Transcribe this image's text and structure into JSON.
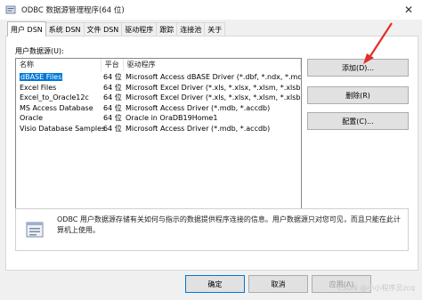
{
  "window": {
    "title": "ODBC 数据源管理程序(64 位)"
  },
  "tabs": [
    "用户 DSN",
    "系统 DSN",
    "文件 DSN",
    "驱动程序",
    "跟踪",
    "连接池",
    "关于"
  ],
  "sources_label": "用户数据源(U):",
  "columns": {
    "name": "名称",
    "platform": "平台",
    "driver": "驱动程序"
  },
  "rows": [
    {
      "name": "dBASE Files",
      "platform": "64 位",
      "driver": "Microsoft Access dBASE Driver (*.dbf, *.ndx, *.md"
    },
    {
      "name": "Excel Files",
      "platform": "64 位",
      "driver": "Microsoft Excel Driver (*.xls, *.xlsx, *.xlsm, *.xlsb)"
    },
    {
      "name": "Excel_to_Oracle12c",
      "platform": "64 位",
      "driver": "Microsoft Excel Driver (*.xls, *.xlsx, *.xlsm, *.xlsb)"
    },
    {
      "name": "MS Access Database",
      "platform": "64 位",
      "driver": "Microsoft Access Driver (*.mdb, *.accdb)"
    },
    {
      "name": "Oracle",
      "platform": "64 位",
      "driver": "Oracle in OraDB19Home1"
    },
    {
      "name": "Visio Database Samples",
      "platform": "64 位",
      "driver": "Microsoft Access Driver (*.mdb, *.accdb)"
    }
  ],
  "buttons": {
    "add": "添加(D)...",
    "remove": "删除(R)",
    "config": "配置(C)...",
    "ok": "确定",
    "cancel": "取消",
    "apply": "应用(A)"
  },
  "info_text": "ODBC 用户数据源存储有关如何与指示的数据提供程序连接的信息。用户数据源只对您可见，而且只能在此计算机上使用。",
  "watermark": "CSDN @小小程序员zcq",
  "colors": {
    "selection": "#0078d7",
    "annotation_arrow": "#e0302a"
  }
}
